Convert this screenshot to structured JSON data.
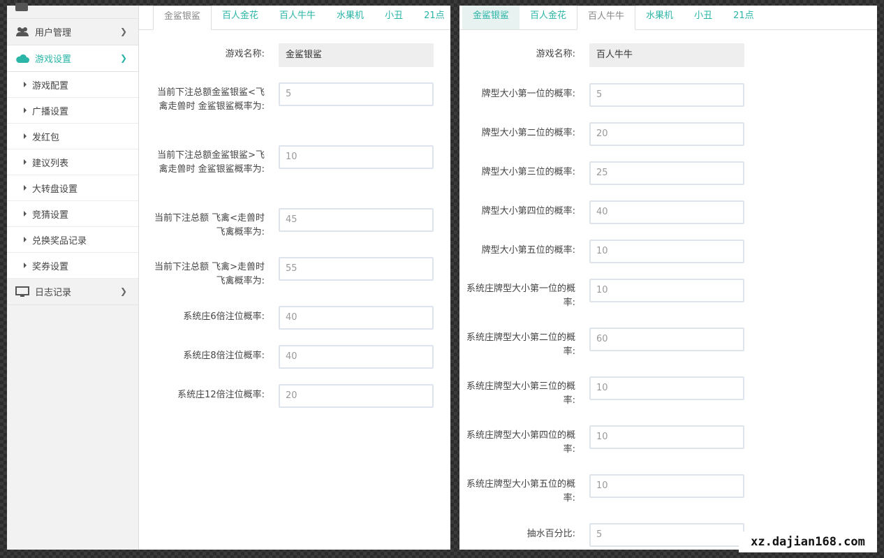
{
  "sidebar": {
    "menus": [
      {
        "label": "用户管理",
        "icon": "users-icon"
      },
      {
        "label": "游戏设置",
        "icon": "cloud-icon"
      },
      {
        "label": "日志记录",
        "icon": "monitor-icon"
      }
    ],
    "submenu": [
      {
        "label": "游戏配置"
      },
      {
        "label": "广播设置"
      },
      {
        "label": "发红包"
      },
      {
        "label": "建议列表"
      },
      {
        "label": "大转盘设置"
      },
      {
        "label": "竞猜设置"
      },
      {
        "label": "兑换奖品记录"
      },
      {
        "label": "奖券设置"
      }
    ],
    "accent_color": "#2ab5a7"
  },
  "left_panel": {
    "tabs": [
      "金鲨银鲨",
      "百人金花",
      "百人牛牛",
      "水果机",
      "小丑",
      "21点"
    ],
    "active_tab": "金鲨银鲨",
    "fields": [
      {
        "label": "游戏名称:",
        "value": "金鲨银鲨"
      },
      {
        "label": "当前下注总额金鲨银鲨<飞禽走兽时 金鲨银鲨概率为:",
        "value": "5"
      },
      {
        "label": "当前下注总额金鲨银鲨>飞禽走兽时 金鲨银鲨概率为:",
        "value": "10"
      },
      {
        "label": "当前下注总额 飞禽<走兽时 飞禽概率为:",
        "value": "45"
      },
      {
        "label": "当前下注总额 飞禽>走兽时 飞禽概率为:",
        "value": "55"
      },
      {
        "label": "系统庄6倍注位概率:",
        "value": "40"
      },
      {
        "label": "系统庄8倍注位概率:",
        "value": "40"
      },
      {
        "label": "系统庄12倍注位概率:",
        "value": "20"
      }
    ]
  },
  "right_panel": {
    "tabs": [
      "金鲨银鲨",
      "百人金花",
      "百人牛牛",
      "水果机",
      "小丑",
      "21点"
    ],
    "active_tab": "百人牛牛",
    "fields": [
      {
        "label": "游戏名称:",
        "value": "百人牛牛"
      },
      {
        "label": "牌型大小第一位的概率:",
        "value": "5"
      },
      {
        "label": "牌型大小第二位的概率:",
        "value": "20"
      },
      {
        "label": "牌型大小第三位的概率:",
        "value": "25"
      },
      {
        "label": "牌型大小第四位的概率:",
        "value": "40"
      },
      {
        "label": "牌型大小第五位的概率:",
        "value": "10"
      },
      {
        "label": "系统庄牌型大小第一位的概率:",
        "value": "10"
      },
      {
        "label": "系统庄牌型大小第二位的概率:",
        "value": "60"
      },
      {
        "label": "系统庄牌型大小第三位的概率:",
        "value": "10"
      },
      {
        "label": "系统庄牌型大小第四位的概率:",
        "value": "10"
      },
      {
        "label": "系统庄牌型大小第五位的概率:",
        "value": "10"
      },
      {
        "label": "抽水百分比:",
        "value": "5"
      }
    ]
  },
  "watermark": "xz.dajian168.com"
}
